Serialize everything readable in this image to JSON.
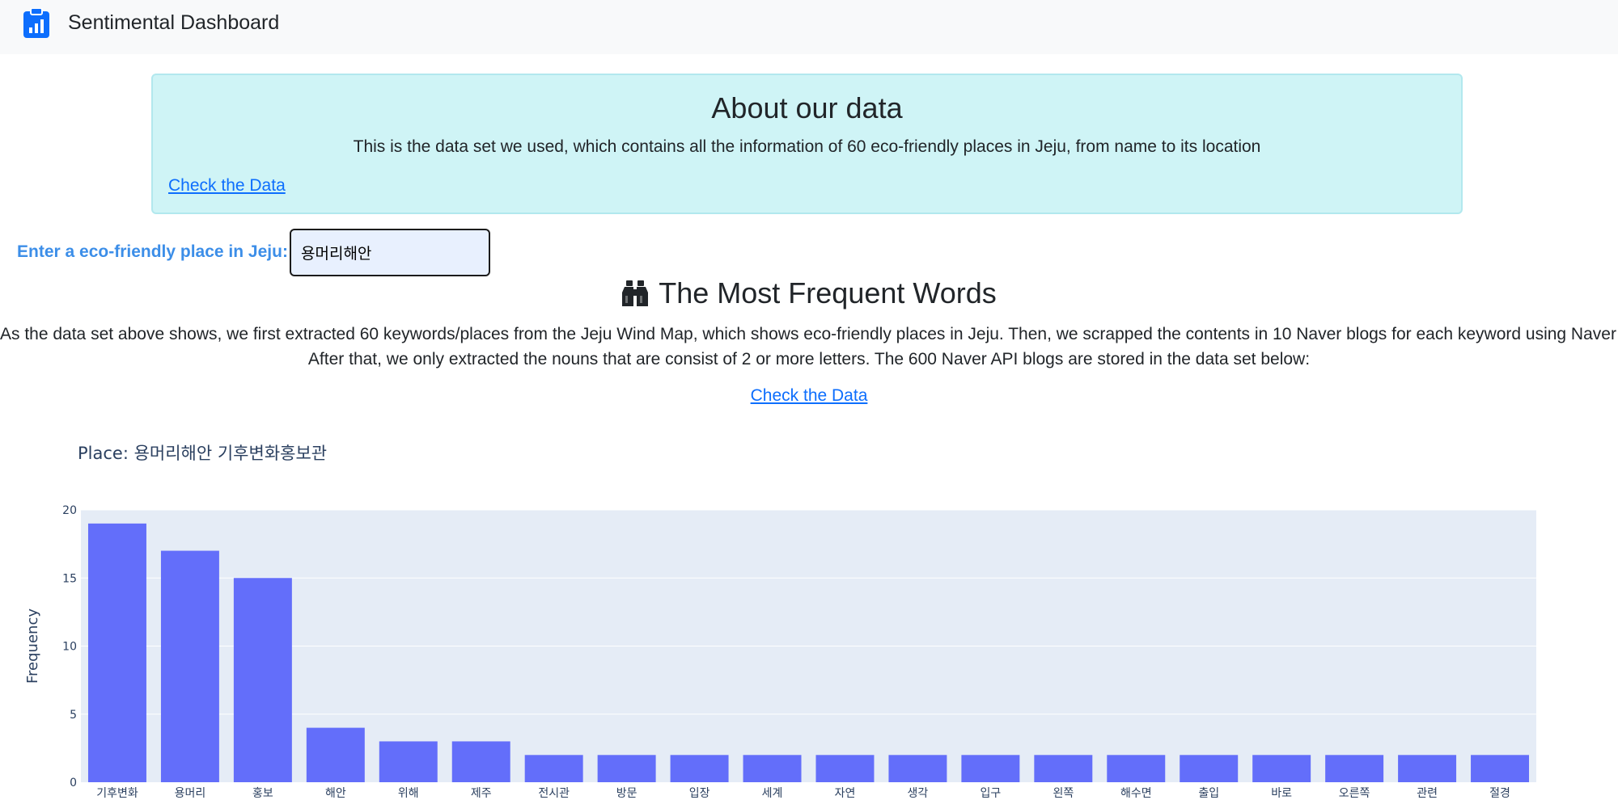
{
  "navbar": {
    "title": "Sentimental Dashboard",
    "icon": "clipboard-chart-icon",
    "icon_color": "#0d6efd"
  },
  "about": {
    "heading": "About our data",
    "text": "This is the data set we used, which contains all the information of 60 eco-friendly places in Jeju, from name to its location",
    "link": "Check the Data"
  },
  "search": {
    "label": "Enter a eco-friendly place in Jeju:",
    "value": "용머리해안"
  },
  "section": {
    "title": "The Most Frequent Words",
    "icon": "binoculars-icon",
    "description_line1": "As the data set above shows, we first extracted 60 keywords/places from the Jeju Wind Map, which shows eco-friendly places in Jeju. Then, we scrapped the contents in 10 Naver blogs for each keyword using Naver API.",
    "description_line2": "After that, we only extracted the nouns that are consist of 2 or more letters. The 600 Naver API blogs are stored in the data set below:",
    "link": "Check the Data"
  },
  "chart_data": {
    "type": "bar",
    "title": "Place: 용머리해안 기후변화홍보관",
    "xlabel": "",
    "ylabel": "Frequency",
    "ylim": [
      0,
      20
    ],
    "yticks": [
      0,
      5,
      10,
      15,
      20
    ],
    "categories": [
      "기후변화",
      "용머리",
      "홍보",
      "해안",
      "위해",
      "제주",
      "전시관",
      "방문",
      "입장",
      "세계",
      "자연",
      "생각",
      "입구",
      "왼쪽",
      "해수면",
      "출입",
      "바로",
      "오른쪽",
      "관련",
      "절경"
    ],
    "values": [
      19,
      17,
      15,
      4,
      3,
      3,
      2,
      2,
      2,
      2,
      2,
      2,
      2,
      2,
      2,
      2,
      2,
      2,
      2,
      2
    ],
    "bar_color": "#636efa",
    "plot_bg": "#e5ecf6",
    "grid": true
  }
}
